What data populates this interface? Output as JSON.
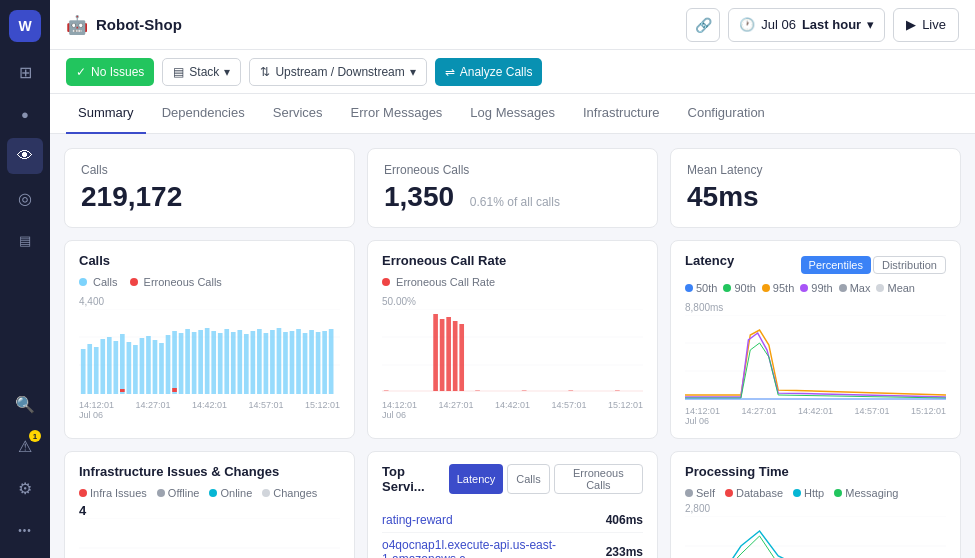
{
  "app": {
    "title": "Robot-Shop",
    "title_icon": "🤖"
  },
  "topbar": {
    "link_btn": "🔗",
    "time_date": "Jul 06",
    "time_label": "Last hour",
    "live_label": "Live"
  },
  "toolbar": {
    "no_issues_label": "No Issues",
    "stack_label": "Stack",
    "upstream_label": "Upstream / Downstream",
    "analyze_label": "Analyze Calls"
  },
  "tabs": [
    {
      "id": "summary",
      "label": "Summary",
      "active": true
    },
    {
      "id": "dependencies",
      "label": "Dependencies",
      "active": false
    },
    {
      "id": "services",
      "label": "Services",
      "active": false
    },
    {
      "id": "error-messages",
      "label": "Error Messages",
      "active": false
    },
    {
      "id": "log-messages",
      "label": "Log Messages",
      "active": false
    },
    {
      "id": "infrastructure",
      "label": "Infrastructure",
      "active": false
    },
    {
      "id": "configuration",
      "label": "Configuration",
      "active": false
    }
  ],
  "summary": {
    "calls_label": "Calls",
    "calls_value": "219,172",
    "erroneous_label": "Erroneous Calls",
    "erroneous_value": "1,350",
    "erroneous_sub": "0.61% of all calls",
    "latency_label": "Mean Latency",
    "latency_value": "45ms"
  },
  "charts": {
    "calls": {
      "title": "Calls",
      "legend_calls": "Calls",
      "legend_erroneous": "Erroneous Calls",
      "ymax": "4,400",
      "xticks": [
        "14:12:01\nJul 06",
        "14:27:01",
        "14:42:01",
        "14:57:01",
        "15:12:01"
      ]
    },
    "erroneous_rate": {
      "title": "Erroneous Call Rate",
      "legend_label": "Erroneous Call Rate",
      "ymax": "50.00%",
      "xticks": [
        "14:12:01\nJul 06",
        "14:27:01",
        "14:42:01",
        "14:57:01",
        "15:12:01"
      ]
    },
    "latency": {
      "title": "Latency",
      "btn_percentiles": "Percentiles",
      "btn_distribution": "Distribution",
      "legend": [
        "50th",
        "90th",
        "95th",
        "99th",
        "Max",
        "Mean"
      ],
      "legend_colors": [
        "#3b82f6",
        "#22c55e",
        "#f59e0b",
        "#a855f7",
        "#9ca3af",
        "#d1d5db"
      ],
      "ymax": "8,800ms",
      "xticks": [
        "14:12:01\nJul 06",
        "14:27:01",
        "14:42:01",
        "14:57:01",
        "15:12:01"
      ]
    }
  },
  "bottom": {
    "infra": {
      "title": "Infrastructure Issues & Changes",
      "legend": [
        "Infra Issues",
        "Offline",
        "Online",
        "Changes"
      ],
      "colors": [
        "#ef4444",
        "#9ca3af",
        "#06b6d4",
        "#d1d5db"
      ],
      "count": "4"
    },
    "top_services": {
      "title": "Top Servi...",
      "tabs": [
        "Latency",
        "Calls",
        "Erroneous Calls"
      ],
      "active_tab": "Latency",
      "rows": [
        {
          "name": "rating-reward",
          "value": "406ms"
        },
        {
          "name": "o4qocnap1l.execute-api.us-east-1.amazonaws.c...",
          "value": "233ms"
        }
      ]
    },
    "processing": {
      "title": "Processing Time",
      "legend": [
        "Self",
        "Database",
        "Http",
        "Messaging"
      ],
      "colors": [
        "#9ca3af",
        "#ef4444",
        "#06b6d4",
        "#22c55e"
      ],
      "ymax": "2,800"
    }
  },
  "sidebar": {
    "items": [
      {
        "icon": "⊞",
        "name": "grid-icon"
      },
      {
        "icon": "◉",
        "name": "circle-icon"
      },
      {
        "icon": "👁",
        "name": "eye-icon",
        "active": true
      },
      {
        "icon": "◎",
        "name": "target-icon"
      },
      {
        "icon": "☰",
        "name": "layers-icon"
      },
      {
        "icon": "🔍",
        "name": "search-icon"
      },
      {
        "icon": "⚠",
        "name": "alert-icon",
        "badge": "1"
      },
      {
        "icon": "⚙",
        "name": "settings-icon"
      },
      {
        "icon": "•••",
        "name": "more-icon"
      }
    ]
  }
}
